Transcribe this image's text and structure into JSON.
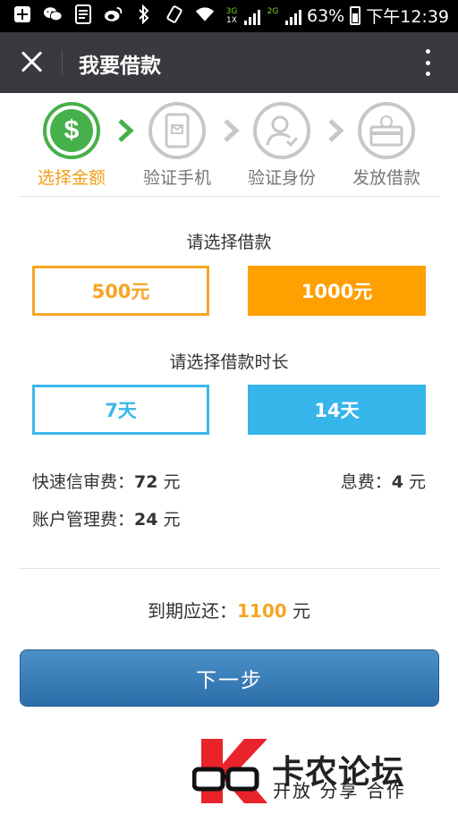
{
  "status_bar": {
    "net_top": "3G",
    "net_bottom": "1X",
    "net2": "2G",
    "battery": "63%",
    "time": "下午12:39",
    "icons": [
      "add-icon",
      "wechat-icon",
      "document-icon",
      "weibo-icon",
      "bluetooth-icon",
      "vibrate-icon",
      "wifi-icon"
    ]
  },
  "header": {
    "title": "我要借款"
  },
  "steps": [
    {
      "label": "选择金额",
      "icon": "dollar-icon",
      "active": true
    },
    {
      "label": "验证手机",
      "icon": "phone-icon",
      "active": false
    },
    {
      "label": "验证身份",
      "icon": "user-check-icon",
      "active": false
    },
    {
      "label": "发放借款",
      "icon": "card-icon",
      "active": false
    }
  ],
  "amount": {
    "title": "请选择借款",
    "options": [
      "500元",
      "1000元"
    ],
    "selected": "1000元"
  },
  "duration": {
    "title": "请选择借款时长",
    "options": [
      "7天",
      "14天"
    ],
    "selected": "14天"
  },
  "fees": {
    "quick_review_label": "快速信审费：",
    "quick_review_value": "72",
    "quick_review_unit": " 元",
    "interest_label": "息费：",
    "interest_value": "4",
    "interest_unit": " 元",
    "account_label": "账户管理费：",
    "account_value": "24",
    "account_unit": " 元"
  },
  "due": {
    "label": "到期应还：",
    "value": "1100",
    "unit": " 元"
  },
  "next_button": "下一步",
  "watermark": {
    "title": "卡农论坛",
    "subtitle": "开放 分享 合作"
  },
  "colors": {
    "green": "#46b04b",
    "orange": "#ff9f00",
    "blue": "#36b5ea",
    "button": "#2b6ea9"
  }
}
